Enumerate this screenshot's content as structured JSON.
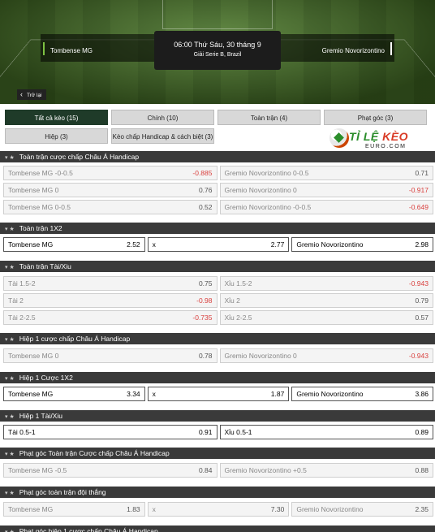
{
  "match": {
    "home": "Tombense MG",
    "away": "Gremio Novorizontino",
    "time": "06:00 Thứ Sáu, 30 tháng 9",
    "league": "Giải Serie B, Brazil",
    "back": "Trở lại"
  },
  "tabs": [
    "Tất cả kèo (15)",
    "Chính (10)",
    "Toàn trận (4)",
    "Phạt góc (3)",
    "Hiệp (3)",
    "Kèo chấp Handicap & cách biệt (3)"
  ],
  "logo": {
    "a": "TỈ LỆ ",
    "b": "KÈO",
    "sub": "EURO.COM"
  },
  "sections": [
    {
      "title": "Toàn trận cược chấp Châu Á Handicap",
      "rows": [
        [
          {
            "n": "Tombense MG -0-0.5",
            "o": "-0.885"
          },
          {
            "n": "Gremio Novorizontino 0-0.5",
            "o": "0.71"
          }
        ],
        [
          {
            "n": "Tombense MG 0",
            "o": "0.76"
          },
          {
            "n": "Gremio Novorizontino 0",
            "o": "-0.917"
          }
        ],
        [
          {
            "n": "Tombense MG 0-0.5",
            "o": "0.52"
          },
          {
            "n": "Gremio Novorizontino -0-0.5",
            "o": "-0.649"
          }
        ]
      ]
    },
    {
      "title": "Toàn trận 1X2",
      "rows": [
        [
          {
            "n": "Tombense MG",
            "o": "2.52"
          },
          {
            "n": "x",
            "o": "2.77"
          },
          {
            "n": "Gremio Novorizontino",
            "o": "2.98"
          }
        ]
      ]
    },
    {
      "title": "Toàn trận Tài/Xiu",
      "rows": [
        [
          {
            "n": "Tài 1.5-2",
            "o": "0.75"
          },
          {
            "n": "Xỉu 1.5-2",
            "o": "-0.943"
          }
        ],
        [
          {
            "n": "Tài 2",
            "o": "-0.98"
          },
          {
            "n": "Xỉu 2",
            "o": "0.79"
          }
        ],
        [
          {
            "n": "Tài 2-2.5",
            "o": "-0.735"
          },
          {
            "n": "Xỉu 2-2.5",
            "o": "0.57"
          }
        ]
      ]
    },
    {
      "title": "Hiệp 1 cược chấp Châu Á Handicap",
      "rows": [
        [
          {
            "n": "Tombense MG 0",
            "o": "0.78"
          },
          {
            "n": "Gremio Novorizontino 0",
            "o": "-0.943"
          }
        ]
      ]
    },
    {
      "title": "Hiệp 1 Cược 1X2",
      "rows": [
        [
          {
            "n": "Tombense MG",
            "o": "3.34"
          },
          {
            "n": "x",
            "o": "1.87"
          },
          {
            "n": "Gremio Novorizontino",
            "o": "3.86"
          }
        ]
      ]
    },
    {
      "title": "Hiệp 1 Tài/Xiu",
      "rows": [
        [
          {
            "n": "Tài 0.5-1",
            "o": "0.91"
          },
          {
            "n": "Xỉu 0.5-1",
            "o": "0.89"
          }
        ]
      ]
    },
    {
      "title": "Phạt góc Toàn trận Cược chấp Châu Á Handicap",
      "rows": [
        [
          {
            "n": "Tombense MG -0.5",
            "o": "0.84"
          },
          {
            "n": "Gremio Novorizontino +0.5",
            "o": "0.88"
          }
        ]
      ]
    },
    {
      "title": "Phạt góc toàn trận đội thắng",
      "rows": [
        [
          {
            "n": "Tombense MG",
            "o": "1.83"
          },
          {
            "n": "x",
            "o": "7.30"
          },
          {
            "n": "Gremio Novorizontino",
            "o": "2.35"
          }
        ]
      ]
    },
    {
      "title": "Phạt góc hiệp 1 cược chấp Châu Á Handicap",
      "rows": []
    }
  ],
  "colors": {
    "header": "#3a3a3a",
    "active_tab": "#1f3b29",
    "negative": "#d9413f",
    "accent": "#7dc242"
  }
}
